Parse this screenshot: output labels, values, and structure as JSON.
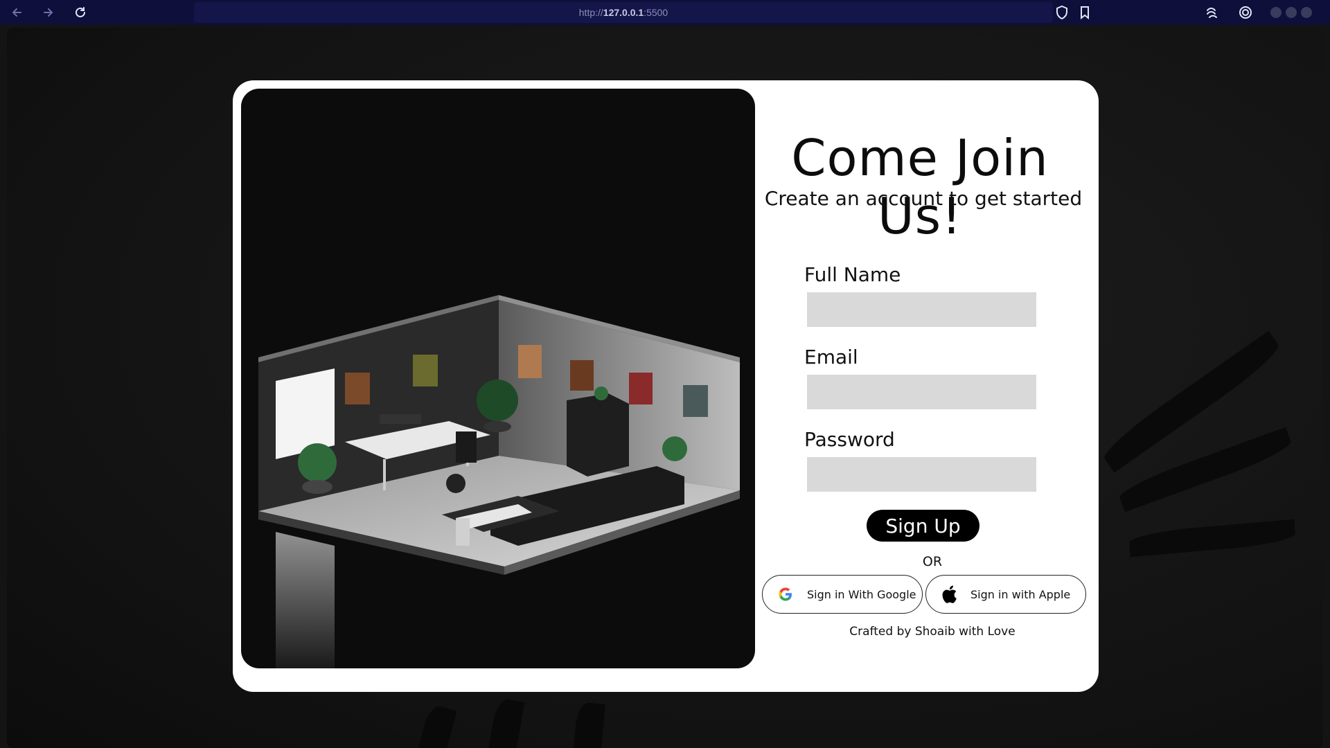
{
  "browser": {
    "url_prefix": "http://",
    "url_host": "127.0.0.1",
    "url_port": ":5500",
    "icons": [
      "back-arrow-icon",
      "forward-arrow-icon",
      "reload-icon",
      "shield-icon",
      "bookmark-icon",
      "extension-icon",
      "target-icon"
    ]
  },
  "hero": {
    "alt": "Isometric dark room illustration"
  },
  "form": {
    "title": "Come Join Us!",
    "subtitle": "Create an account to get started",
    "fields": [
      {
        "label": "Full Name",
        "value": "",
        "placeholder": ""
      },
      {
        "label": "Email",
        "value": "",
        "placeholder": ""
      },
      {
        "label": "Password",
        "value": "",
        "placeholder": ""
      }
    ],
    "submit_label": "Sign Up",
    "or_text": "OR",
    "google_label": "Sign in With Google",
    "apple_label": "Sign in with Apple",
    "footer": "Crafted by Shoaib with Love"
  },
  "colors": {
    "browser_bar": "#0e0f3a",
    "card": "#ffffff",
    "input_bg": "#d9d9d9",
    "button_bg": "#000000"
  }
}
